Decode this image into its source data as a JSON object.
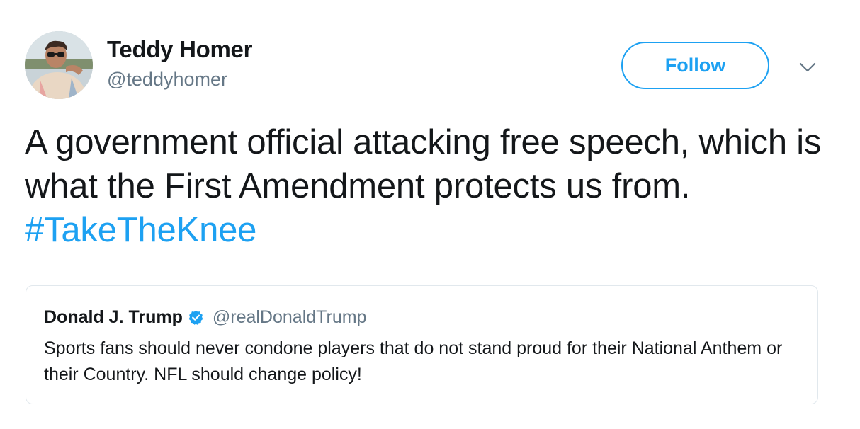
{
  "author": {
    "display_name": "Teddy Homer",
    "handle": "@teddyhomer",
    "avatar_icon": "profile-photo"
  },
  "actions": {
    "follow_label": "Follow",
    "menu_icon": "chevron-down-icon"
  },
  "tweet": {
    "text": "A government official attacking free speech, which is what the First Amendment protects us from. ",
    "hashtag": "#TakeTheKnee"
  },
  "quoted_tweet": {
    "display_name": "Donald J. Trump",
    "verified": true,
    "handle": "@realDonaldTrump",
    "text": "Sports fans should never condone players that do not stand proud for their National Anthem or their Country. NFL should change policy!"
  },
  "colors": {
    "accent": "#1da1f2",
    "text": "#14171a",
    "muted": "#657786",
    "border": "#e1e8ed"
  }
}
